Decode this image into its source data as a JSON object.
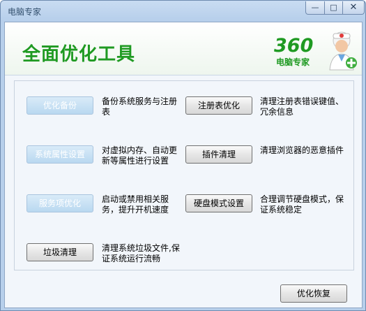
{
  "window": {
    "title": "电脑专家"
  },
  "header": {
    "headline": "全面优化工具",
    "brand_number": "360",
    "brand_name": "电脑专家"
  },
  "left_items": [
    {
      "button": "优化备份",
      "desc": "备份系统服务与注册表",
      "enabled": false
    },
    {
      "button": "系统属性设置",
      "desc": "对虚拟内存、自动更新等属性进行设置",
      "enabled": false
    },
    {
      "button": "服务项优化",
      "desc": "启动或禁用相关服务，提升开机速度",
      "enabled": false
    },
    {
      "button": "垃圾清理",
      "desc": "清理系统垃圾文件,保证系统运行流畅",
      "enabled": true
    }
  ],
  "right_items": [
    {
      "button": "注册表优化",
      "desc": "清理注册表错误键值、冗余信息",
      "enabled": true
    },
    {
      "button": "插件清理",
      "desc": "清理浏览器的恶意插件",
      "enabled": true
    },
    {
      "button": "硬盘模式设置",
      "desc": "合理调节硬盘模式，保证系统稳定",
      "enabled": true
    }
  ],
  "footer": {
    "restore_label": "优化恢复"
  },
  "colors": {
    "brand_green": "#1f9a22",
    "disabled_button": "#c6e0f4"
  }
}
